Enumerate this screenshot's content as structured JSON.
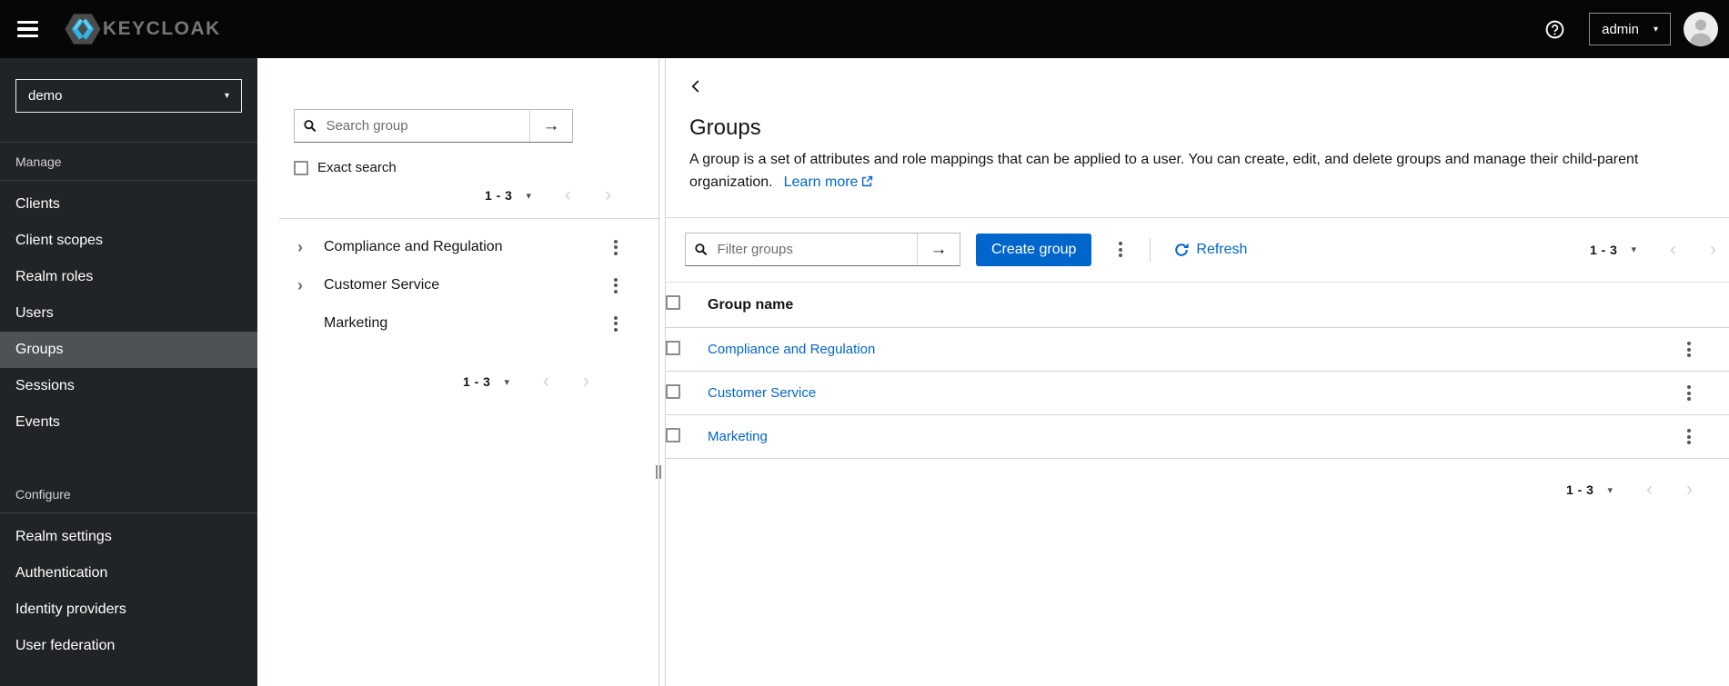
{
  "topbar": {
    "brand": "KEYCLOAK",
    "username": "admin"
  },
  "sidebar": {
    "realm": "demo",
    "selected_item": "Groups",
    "manage": {
      "label": "Manage",
      "items": [
        "Clients",
        "Client scopes",
        "Realm roles",
        "Users",
        "Groups",
        "Sessions",
        "Events"
      ]
    },
    "configure": {
      "label": "Configure",
      "items": [
        "Realm settings",
        "Authentication",
        "Identity providers",
        "User federation"
      ]
    }
  },
  "group_tree": {
    "search_placeholder": "Search group",
    "exact_search_label": "Exact search",
    "pagination_top": {
      "range": "1 - 3"
    },
    "pagination_bottom": {
      "range": "1 - 3"
    },
    "items": [
      {
        "name": "Compliance and Regulation",
        "expandable": true
      },
      {
        "name": "Customer Service",
        "expandable": true
      },
      {
        "name": "Marketing",
        "expandable": false
      }
    ]
  },
  "main": {
    "title": "Groups",
    "description": "A group is a set of attributes and role mappings that can be applied to a user. You can create, edit, and delete groups and manage their child-parent organization.",
    "learn_more_label": "Learn more",
    "toolbar": {
      "filter_placeholder": "Filter groups",
      "create_button_label": "Create group",
      "refresh_label": "Refresh",
      "pagination": {
        "range": "1 - 3"
      }
    },
    "table": {
      "columns": [
        "Group name"
      ],
      "rows": [
        "Compliance and Regulation",
        "Customer Service",
        "Marketing"
      ]
    },
    "pagination_bottom": {
      "range": "1 - 3"
    }
  },
  "colors": {
    "primary": "#0066cc",
    "link": "#0066cc",
    "masthead": "#060606",
    "sidebar_bg": "#212427",
    "sidebar_selected": "#4f5255"
  }
}
